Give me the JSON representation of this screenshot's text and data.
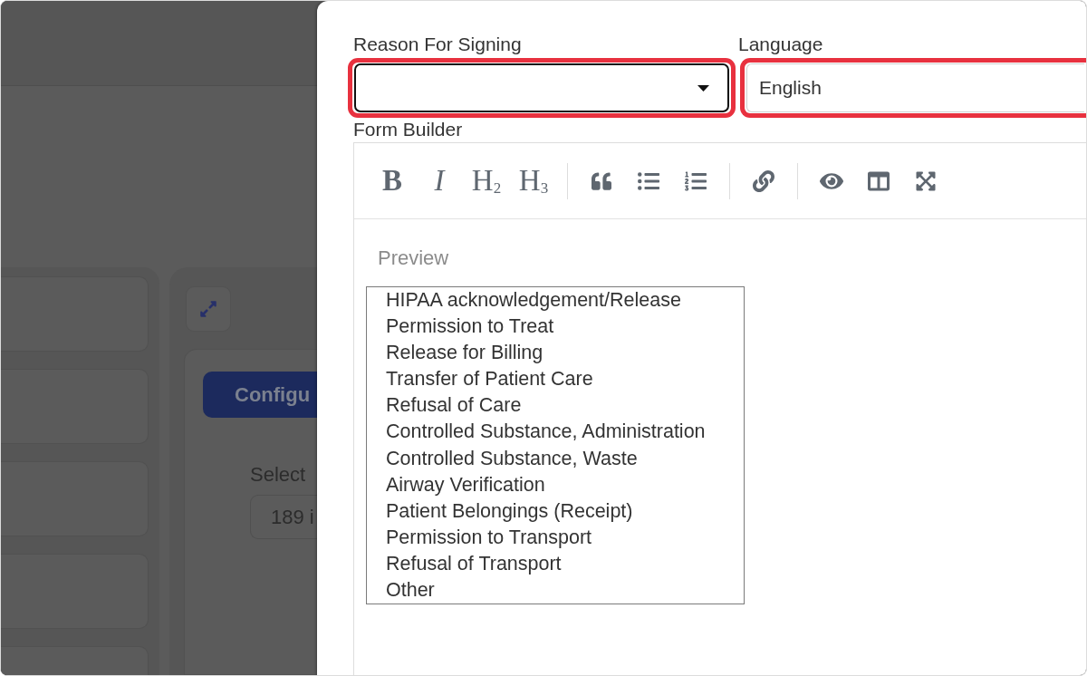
{
  "background": {
    "primary_button": "Configu",
    "field_label": "Select",
    "field_value": "189 i"
  },
  "drawer": {
    "reason_field": {
      "label": "Reason For Signing",
      "focused": true,
      "highlighted": true
    },
    "language_field": {
      "label": "Language",
      "value": "English",
      "focused": false,
      "highlighted": true
    },
    "form_builder": {
      "label": "Form Builder",
      "toolbar": [
        {
          "kind": "bold",
          "label": "B"
        },
        {
          "kind": "italic",
          "label": "I"
        },
        {
          "kind": "heading",
          "label": "H$_{2}$"
        },
        {
          "kind": "heading",
          "label": "H$_{3}$"
        }
      ],
      "preview": {
        "label": "Preview",
        "options": [
          {
            "label": "HIPAA acknowledgement/Release",
            "selected": false
          },
          {
            "label": "Permission to Treat",
            "selected": false
          },
          {
            "label": "Release for Billing",
            "selected": false
          },
          {
            "label": "Transfer of Patient Care",
            "selected": false
          },
          {
            "label": "Refusal of Care",
            "selected": false
          },
          {
            "label": "Controlled Substance, Administration",
            "selected": false
          },
          {
            "label": "Controlled Substance, Waste",
            "selected": false
          },
          {
            "label": "Airway Verification",
            "selected": false
          },
          {
            "label": "Patient Belongings (Receipt)",
            "selected": false
          },
          {
            "label": "Permission to Transport",
            "selected": false
          },
          {
            "label": "Refusal of Transport",
            "selected": false
          },
          {
            "label": "Other",
            "selected": false
          }
        ]
      }
    }
  }
}
